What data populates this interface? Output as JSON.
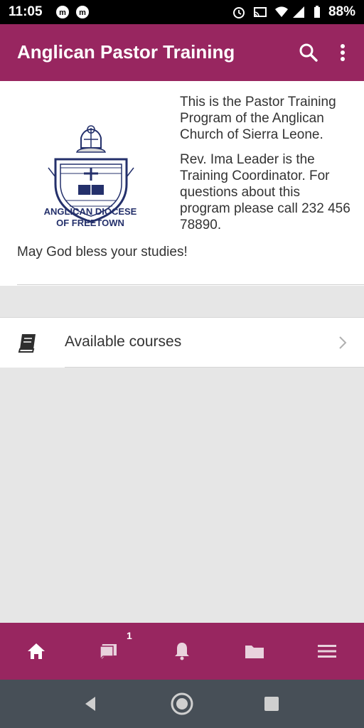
{
  "status": {
    "time": "11:05",
    "battery": "88%"
  },
  "app_bar": {
    "title": "Anglican Pastor Training"
  },
  "logo": {
    "text_line1": "ANGLICAN DIOCESE",
    "text_line2": "OF FREETOWN"
  },
  "intro": {
    "p1": "This is the Pastor Training Program of the Anglican Church of Sierra Leone.",
    "p2": "Rev. Ima Leader is the Training Coordinator. For questions about this program please call 232 456 78890."
  },
  "blessing": "May God bless your studies!",
  "courses": {
    "label": "Available courses"
  },
  "bottom_nav": {
    "messages_badge": "1"
  },
  "colors": {
    "brand": "#982660",
    "sys_nav": "#474f57"
  }
}
